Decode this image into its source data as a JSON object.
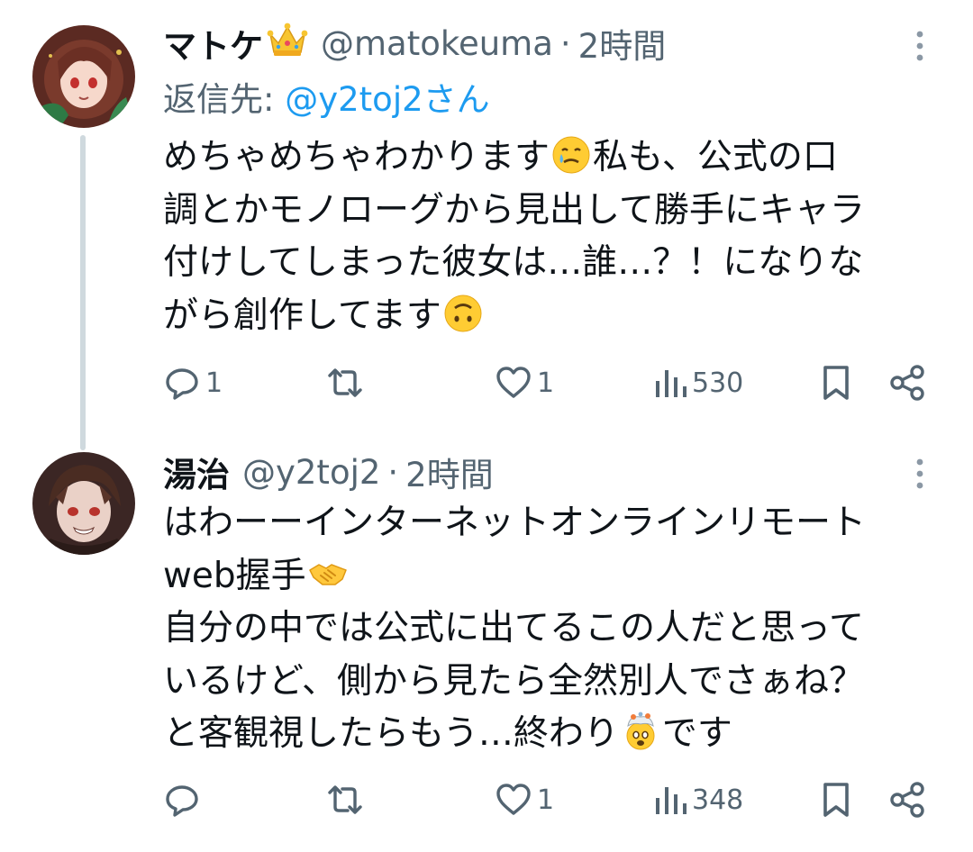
{
  "colors": {
    "primary_text": "#0f1419",
    "secondary_text": "#536471",
    "link": "#1d9bf0",
    "thread_line": "#cfd9de"
  },
  "tweets": [
    {
      "display_name": "マトケ",
      "badge": "crown-emoji",
      "handle": "@matokeuma",
      "separator": "·",
      "time": "2時間",
      "reply_label": "返信先:",
      "reply_mention": "@y2toj2さん",
      "body_lines": [
        [
          "めちゃめちゃわかります",
          "🥲",
          "私も、公式の口"
        ],
        [
          "調とかモノローグから見出して勝手にキャラ"
        ],
        [
          "付けしてしまった彼女は…誰…？！になりな"
        ],
        [
          "がら創作してます",
          "🙃"
        ]
      ],
      "actions": {
        "reply_count": "1",
        "retweet_count": "",
        "like_count": "1",
        "view_count": "530"
      }
    },
    {
      "display_name": "湯治",
      "handle": "@y2toj2",
      "separator": "·",
      "time": "2時間",
      "body_lines": [
        [
          "はわーーインターネットオンラインリモート"
        ],
        [
          "web握手",
          "🤝"
        ],
        [
          "自分の中では公式に出てるこの人だと思って"
        ],
        [
          "いるけど、側から見たら全然別人でさぁね？"
        ],
        [
          "と客観視したらもう…終わり",
          "🤯",
          "です"
        ]
      ],
      "actions": {
        "reply_count": "",
        "retweet_count": "",
        "like_count": "1",
        "view_count": "348"
      }
    }
  ]
}
